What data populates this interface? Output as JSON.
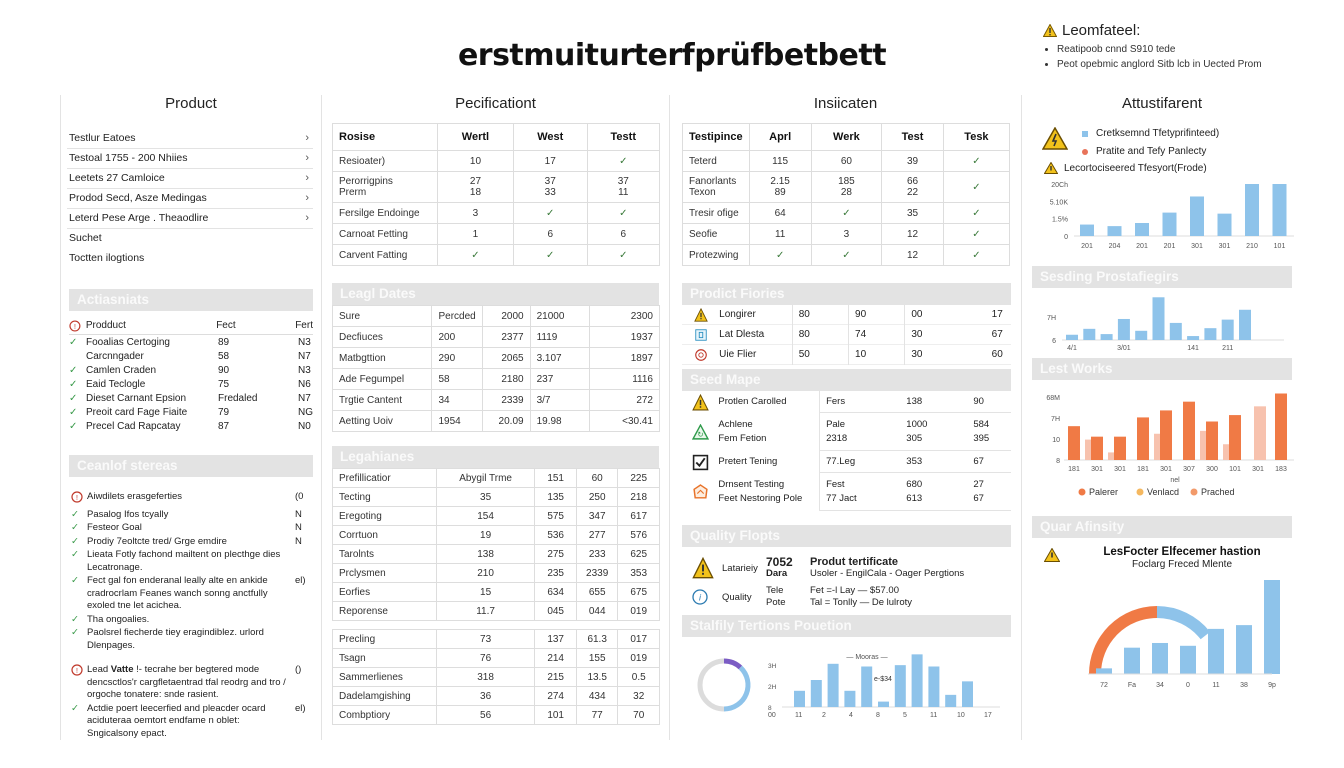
{
  "page_title": "erstmuiturterfprüfbetbett",
  "alert": {
    "title": "Leomfateel:",
    "items": [
      "Reatipoob cnnd S910 tede",
      "Peot opebmic anglord Sitb lcb in Uected Prom"
    ]
  },
  "columns": {
    "product": {
      "title": "Product",
      "items": [
        {
          "label": "Testlur Eatoes",
          "chevron": true
        },
        {
          "label": "Testoal 1755 - 200 Nhiies",
          "chevron": true
        },
        {
          "label": "Leetets 27 Camloice",
          "chevron": true
        },
        {
          "label": "Prodod Secd, Asze Medingas",
          "chevron": true
        },
        {
          "label": "Leterd Pese Arge . Theaodlire",
          "chevron": true
        },
        {
          "label": "Suchet",
          "chevron": false
        },
        {
          "label": "Toctten ilogtions",
          "chevron": false
        }
      ],
      "actions": {
        "section_title": "Actiasniats",
        "header": [
          "Prodduct",
          "Fect",
          "Fert"
        ],
        "rows": [
          {
            "check": true,
            "name": "Fooalias Certoging",
            "a": "89",
            "b": "N3"
          },
          {
            "check": false,
            "name": "Carcnngader",
            "a": "58",
            "b": "N7"
          },
          {
            "check": true,
            "name": "Camlen Craden",
            "a": "90",
            "b": "N3"
          },
          {
            "check": true,
            "name": "Eaid Teclogle",
            "a": "75",
            "b": "N6"
          },
          {
            "check": true,
            "name": "Dieset Carnant Epsion",
            "a": "Fredaled",
            "b": "N7"
          },
          {
            "check": true,
            "name": "Preoit card Fage Fiaite",
            "a": "79",
            "b": "NG"
          },
          {
            "check": true,
            "name": "Precel Cad Rapcatay",
            "a": "87",
            "b": "N0"
          }
        ]
      },
      "checklist": {
        "section_title": "Ceanlof stereas",
        "items": [
          {
            "icon": "info",
            "text": "Aiwdilets erasgeferties",
            "flag": "(0"
          },
          {
            "icon": "check",
            "text": "Pasalog Ifos tcyally",
            "flag": "N"
          },
          {
            "icon": "check",
            "text": "Festeor Goal",
            "flag": "N"
          },
          {
            "icon": "check",
            "text": "Prodiy 7eoltcte tred/ Grge emdire",
            "flag": "N"
          },
          {
            "icon": "check",
            "text": "Lieata Fotly fachond mailtent on plecthge dies Lecatronage.",
            "flag": ""
          },
          {
            "icon": "check",
            "text": "Fect gal fon enderanal leally alte en ankide cradrocrlam Feanes wanch sonng anctfully exoled tne let acichea.",
            "flag": "el)"
          },
          {
            "icon": "check",
            "text": "Tha ongoalies.",
            "flag": ""
          },
          {
            "icon": "check",
            "text": "Paolsrel fiecherde tiey eragindiblez. urlord Dlenpages.",
            "flag": ""
          },
          {
            "icon": "info",
            "bold": "Vatte",
            "text_pre": "Lead",
            "text": "!- tecrahe ber begtered mode dencsctlos'r cargfletaentrad tfal reodrg and tro / orgoche tonatere: snde rasient.",
            "flag": "()"
          },
          {
            "icon": "check",
            "text": "Actdie poert leecerfied and pleacder ocard aciduteraa oemtort endfame n oblet: Sngicalsony epact.",
            "flag": "el)"
          }
        ]
      }
    },
    "specification": {
      "title": "Pecificationt",
      "table": {
        "headers": [
          "Rosise",
          "Wertl",
          "West",
          "Testt"
        ],
        "rows": [
          {
            "name": [
              "Resioater)"
            ],
            "v": [
              [
                "10"
              ],
              [
                "17"
              ],
              [
                "✓"
              ]
            ]
          },
          {
            "name": [
              "Perorrigpins",
              "Prerm"
            ],
            "v": [
              [
                "27",
                "18"
              ],
              [
                "37",
                "33"
              ],
              [
                "37",
                "11"
              ]
            ]
          },
          {
            "name": [
              "Fersilge Endoinge"
            ],
            "v": [
              [
                "3"
              ],
              [
                "✓"
              ],
              [
                "✓"
              ]
            ]
          },
          {
            "name": [
              "Carnoat Fetting"
            ],
            "v": [
              [
                "1"
              ],
              [
                "6"
              ],
              [
                "6"
              ]
            ]
          },
          {
            "name": [
              "Carvent Fatting"
            ],
            "v": [
              [
                "✓"
              ],
              [
                "✓"
              ],
              [
                "✓"
              ]
            ]
          }
        ]
      },
      "legal_dates": {
        "section_title": "Leagl Dates",
        "rows": [
          [
            "Sure",
            "Percded",
            "2000",
            "21000",
            "2300"
          ],
          [
            "Decfiuces",
            "200",
            "2377",
            "1119",
            "1937"
          ],
          [
            "Matbgttion",
            "290",
            "2065",
            "3.107",
            "1897"
          ],
          [
            "Ade Fegumpel",
            "58",
            "2180",
            "237",
            "1116"
          ],
          [
            "Trgtie Cantent",
            "34",
            "2339",
            "3/7",
            "272"
          ],
          [
            "Aetting Uoiv",
            "1954",
            "20.09",
            "19.98",
            "<30.41"
          ]
        ]
      },
      "legal_lines": {
        "section_title": "Legahianes",
        "rows_a": [
          [
            "Prefillicatior",
            "Abygil Trme",
            "151",
            "60",
            "225"
          ],
          [
            "Tecting",
            "35",
            "135",
            "250",
            "218"
          ],
          [
            "Eregoting",
            "154",
            "575",
            "347",
            "617"
          ],
          [
            "Corrtuon",
            "19",
            "536",
            "277",
            "576"
          ],
          [
            "Tarolnts",
            "138",
            "275",
            "233",
            "625"
          ],
          [
            "Prclysmen",
            "210",
            "235",
            "2339",
            "353"
          ],
          [
            "Eorfies",
            "15",
            "634",
            "655",
            "675"
          ],
          [
            "Reporense",
            "11.7",
            "045",
            "044",
            "019"
          ]
        ],
        "rows_b": [
          [
            "Precling",
            "73",
            "137",
            "61.3",
            "017"
          ],
          [
            "Tsagn",
            "76",
            "214",
            "155",
            "019"
          ],
          [
            "Sammerlienes",
            "318",
            "215",
            "13.5",
            "0.5"
          ],
          [
            "Dadelamgishing",
            "36",
            "274",
            "434",
            "32"
          ],
          [
            "Combptiory",
            "56",
            "101",
            "77",
            "70"
          ]
        ]
      }
    },
    "indications": {
      "title": "Insiicaten",
      "table": {
        "headers": [
          "Testipince",
          "Aprl",
          "Werk",
          "Test",
          "Tesk"
        ],
        "rows": [
          {
            "name": [
              "Teterd"
            ],
            "v": [
              [
                "115"
              ],
              [
                "60"
              ],
              [
                "39"
              ],
              [
                "✓"
              ]
            ]
          },
          {
            "name": [
              "Fanorlants",
              "Texon"
            ],
            "v": [
              [
                "2.15",
                "89"
              ],
              [
                "185",
                "28"
              ],
              [
                "66",
                "22"
              ],
              [
                "✓"
              ]
            ]
          },
          {
            "name": [
              "Tresir ofige"
            ],
            "v": [
              [
                "64"
              ],
              [
                "✓"
              ],
              [
                "35"
              ],
              [
                "✓"
              ]
            ]
          },
          {
            "name": [
              "Seofie"
            ],
            "v": [
              [
                "11"
              ],
              [
                "3"
              ],
              [
                "12"
              ],
              [
                "✓"
              ]
            ]
          },
          {
            "name": [
              "Protezwing"
            ],
            "v": [
              [
                "✓"
              ],
              [
                "✓"
              ],
              [
                "12"
              ],
              [
                "✓"
              ]
            ]
          }
        ]
      },
      "product_fiories": {
        "section_title": "Prodict Fiories",
        "rows": [
          {
            "icon": "warning",
            "name": "Longirer",
            "v": [
              "80",
              "90",
              "00",
              "17"
            ]
          },
          {
            "icon": "document",
            "name": "Lat Dlesta",
            "v": [
              "80",
              "74",
              "30",
              "67"
            ]
          },
          {
            "icon": "target",
            "name": "Uie Flier",
            "v": [
              "50",
              "10",
              "30",
              "60"
            ]
          }
        ]
      },
      "seed_maps": {
        "section_title": "Seed Mape",
        "rows": [
          {
            "icon": "warning",
            "names": [
              "Protlen Carolled"
            ],
            "v": [
              [
                "Fers"
              ],
              [
                "138"
              ],
              [
                "90"
              ]
            ]
          },
          {
            "icon": "recycle",
            "names": [
              "Achlene",
              "Fem Fetion"
            ],
            "v": [
              [
                "Pale",
                "2318"
              ],
              [
                "1000",
                "305"
              ],
              [
                "584",
                "395"
              ]
            ]
          },
          {
            "icon": "checkbox",
            "names": [
              "Pretert Tening"
            ],
            "v": [
              [
                "77.Leg"
              ],
              [
                "353"
              ],
              [
                "67"
              ]
            ]
          },
          {
            "icon": "badge",
            "names": [
              "Drnsent Testing",
              "Feet Nestoring Pole"
            ],
            "v": [
              [
                "Fest",
                "77 Jact"
              ],
              [
                "680",
                "613"
              ],
              [
                "27",
                "67"
              ]
            ]
          }
        ]
      },
      "quality": {
        "section_title": "Quality Flopts",
        "rows": [
          {
            "icon": "warning",
            "label": "Latarieiy",
            "code": "7052",
            "code2": "Dara",
            "title": "Produt tertificate",
            "sub": "Usoler - EngilCala - Oager Pergtions"
          },
          {
            "icon": "info",
            "label": "Quality",
            "code": "Tele",
            "code2": "Pote",
            "title": "Fet =-l Lay  — $57.00",
            "sub": "Tal = Tonlly — De lulroty"
          }
        ]
      },
      "stability": {
        "section_title": "Stalfily Tertions Pouetion"
      }
    },
    "affordance": {
      "title": "Attustifarent",
      "legend": [
        {
          "label": "Cretksemnd Tfetyprifinteed)",
          "color": "#8ec3ea"
        },
        {
          "label": "Pratite and Tefy Panlecty",
          "color": "#e8735a"
        }
      ],
      "subtitle": "Lecortociseered Tfesyort(Frode)",
      "seeding_title": "Sesding Prostafiegirs",
      "last_works_title": "Lest Works",
      "quality_title": "Quar Afinsity",
      "quality_heading": "LesFocter Elfecemer hastion",
      "quality_sub": "Foclarg Freced Mlente"
    }
  },
  "chart_data": [
    {
      "type": "bar",
      "title": "Lecortociseered Tfesyort(Frode)",
      "categories": [
        "201",
        "204",
        "201",
        "201",
        "301",
        "301",
        "210",
        "101"
      ],
      "values": [
        22,
        19,
        25,
        45,
        76,
        43,
        100,
        100
      ],
      "ytick_labels": [
        "0",
        "1.5%",
        "5.10K",
        "20Ch"
      ],
      "ylim": [
        0,
        100
      ]
    },
    {
      "type": "bar",
      "title": "Sesding Prostafiegirs",
      "values": [
        8,
        17,
        9,
        32,
        14,
        65,
        26,
        6,
        18,
        31,
        46
      ],
      "xtick_labels": [
        "4/1",
        "3/01",
        "141",
        "211"
      ],
      "ytick_labels": [
        "6",
        "7H"
      ],
      "ylim": [
        0,
        70
      ]
    },
    {
      "type": "bar",
      "title": "Lest Works",
      "xlabel": "nel",
      "categories": [
        "181",
        "301",
        "301",
        "181",
        "301",
        "307",
        "300",
        "101",
        "301",
        "183"
      ],
      "series": [
        {
          "name": "Palerer",
          "color": "#f07a45",
          "values": [
            58,
            40,
            40,
            73,
            85,
            100,
            66,
            77,
            null,
            114
          ]
        },
        {
          "name": "Prached",
          "color": "#f7c2ae",
          "values": [
            null,
            35,
            13,
            null,
            45,
            null,
            50,
            27,
            92,
            null
          ]
        }
      ],
      "legend": [
        "Palerer",
        "Venlacd",
        "Prached"
      ],
      "legend_colors": [
        "#f07a45",
        "#f5b860",
        "#f29a6a"
      ],
      "ytick_labels": [
        "8",
        "10",
        "7H",
        "68M"
      ],
      "ylim": [
        0,
        120
      ]
    },
    {
      "type": "bar",
      "title": "Mooras",
      "categories": [
        "11",
        "2",
        "4",
        "8",
        "5",
        "11",
        "10",
        "17"
      ],
      "values": [
        12,
        20,
        32,
        12,
        30,
        4,
        31,
        39,
        30,
        9,
        19
      ],
      "xtick_labels": [
        "00",
        "11",
        "2",
        "4",
        "8",
        "5",
        "11",
        "10",
        "17"
      ],
      "ytick_labels": [
        "8",
        "2H",
        "3H"
      ],
      "annotation": "e-$34",
      "ylim": [
        0,
        40
      ]
    },
    {
      "type": "pie",
      "title": "Stalfily donut",
      "slices": [
        {
          "label": "purple",
          "value": 12,
          "color": "#7b5cc4"
        },
        {
          "label": "blue",
          "value": 38,
          "color": "#8ec3ea"
        },
        {
          "label": "gray",
          "value": 50,
          "color": "#dcdcdc"
        }
      ]
    },
    {
      "type": "bar",
      "title": "LesFocter Elfecemer hastion",
      "categories": [
        "72",
        "Fa",
        "34",
        "0",
        "11",
        "38",
        "9p"
      ],
      "values": [
        6,
        28,
        33,
        30,
        48,
        52,
        100
      ],
      "gauge": {
        "orange_fraction": 0.5,
        "blue_fraction": 0.5
      },
      "ylim": [
        0,
        100
      ]
    }
  ]
}
